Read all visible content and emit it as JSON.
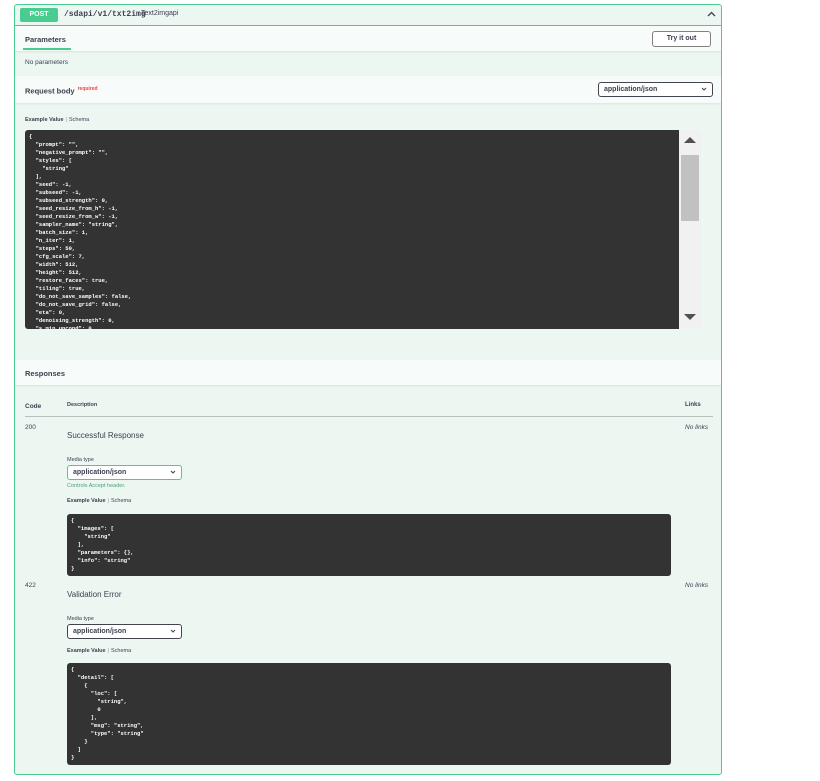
{
  "summary": {
    "method": "POST",
    "path": "/sdapi/v1/txt2img",
    "description": "Text2imgapi"
  },
  "parameters": {
    "title": "Parameters",
    "try_button": "Try it out",
    "empty_text": "No parameters"
  },
  "request_body": {
    "title": "Request body",
    "required": "required",
    "content_type": "application/json",
    "example_tab": "Example Value",
    "schema_tab": "Schema",
    "example_code": "{\n  \"prompt\": \"\",\n  \"negative_prompt\": \"\",\n  \"styles\": [\n    \"string\"\n  ],\n  \"seed\": -1,\n  \"subseed\": -1,\n  \"subseed_strength\": 0,\n  \"seed_resize_from_h\": -1,\n  \"seed_resize_from_w\": -1,\n  \"sampler_name\": \"string\",\n  \"batch_size\": 1,\n  \"n_iter\": 1,\n  \"steps\": 50,\n  \"cfg_scale\": 7,\n  \"width\": 512,\n  \"height\": 512,\n  \"restore_faces\": true,\n  \"tiling\": true,\n  \"do_not_save_samples\": false,\n  \"do_not_save_grid\": false,\n  \"eta\": 0,\n  \"denoising_strength\": 0,\n  \"s_min_uncond\": 0"
  },
  "responses": {
    "title": "Responses",
    "col_code": "Code",
    "col_description": "Description",
    "col_links": "Links",
    "items": [
      {
        "code": "200",
        "description": "Successful Response",
        "links": "No links",
        "media_type_label": "Media type",
        "media_type": "application/json",
        "controls_note": "Controls Accept header.",
        "example_tab": "Example Value",
        "schema_tab": "Schema",
        "example_code": "{\n  \"images\": [\n    \"string\"\n  ],\n  \"parameters\": {},\n  \"info\": \"string\"\n}"
      },
      {
        "code": "422",
        "description": "Validation Error",
        "links": "No links",
        "media_type_label": "Media type",
        "media_type": "application/json",
        "example_tab": "Example Value",
        "schema_tab": "Schema",
        "example_code": "{\n  \"detail\": [\n    {\n      \"loc\": [\n        \"string\",\n        0\n      ],\n      \"msg\": \"string\",\n      \"type\": \"string\"\n    }\n  ]\n}"
      }
    ]
  }
}
